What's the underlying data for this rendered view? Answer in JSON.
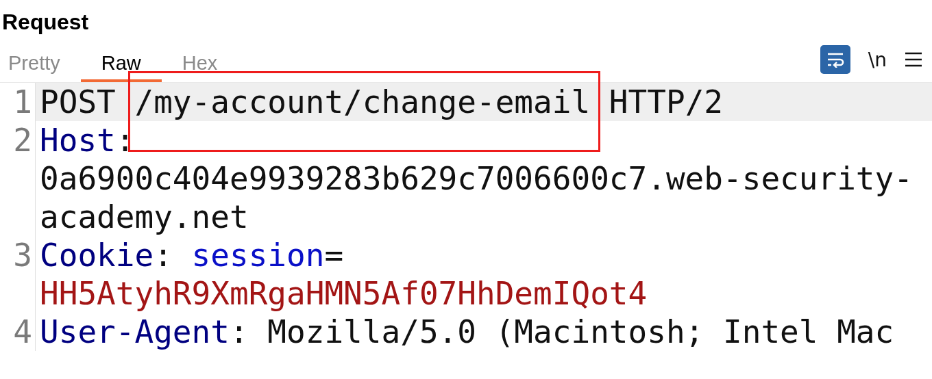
{
  "title": "Request",
  "tabs": [
    {
      "label": "Pretty",
      "selected": false
    },
    {
      "label": "Raw",
      "selected": true
    },
    {
      "label": "Hex",
      "selected": false
    }
  ],
  "toolbar": {
    "wrap_enabled": true,
    "newline_label": "\\n"
  },
  "lines": [
    {
      "number": "1",
      "selected": true,
      "rows": [
        [
          {
            "kind": "plain",
            "text": "POST "
          },
          {
            "kind": "plain",
            "text": "/my-account/change-email",
            "highlighted": true
          },
          {
            "kind": "plain",
            "text": " HTTP/2"
          }
        ]
      ]
    },
    {
      "number": "2",
      "selected": false,
      "rows": [
        [
          {
            "kind": "header",
            "text": "Host"
          },
          {
            "kind": "plain",
            "text": ":"
          }
        ],
        [
          {
            "kind": "plain",
            "text": "0a6900c404e9939283b629c7006600c7.web-security-"
          }
        ],
        [
          {
            "kind": "plain",
            "text": "academy.net"
          }
        ]
      ]
    },
    {
      "number": "3",
      "selected": false,
      "rows": [
        [
          {
            "kind": "header",
            "text": "Cookie"
          },
          {
            "kind": "plain",
            "text": ": "
          },
          {
            "kind": "param",
            "text": "session"
          },
          {
            "kind": "plain",
            "text": "="
          }
        ],
        [
          {
            "kind": "value",
            "text": "HH5AtyhR9XmRgaHMN5Af07HhDemIQot4"
          }
        ]
      ]
    },
    {
      "number": "4",
      "selected": false,
      "rows": [
        [
          {
            "kind": "header",
            "text": "User-Agent"
          },
          {
            "kind": "plain",
            "text": ": Mozilla/5.0 (Macintosh; Intel Mac"
          }
        ]
      ]
    }
  ]
}
